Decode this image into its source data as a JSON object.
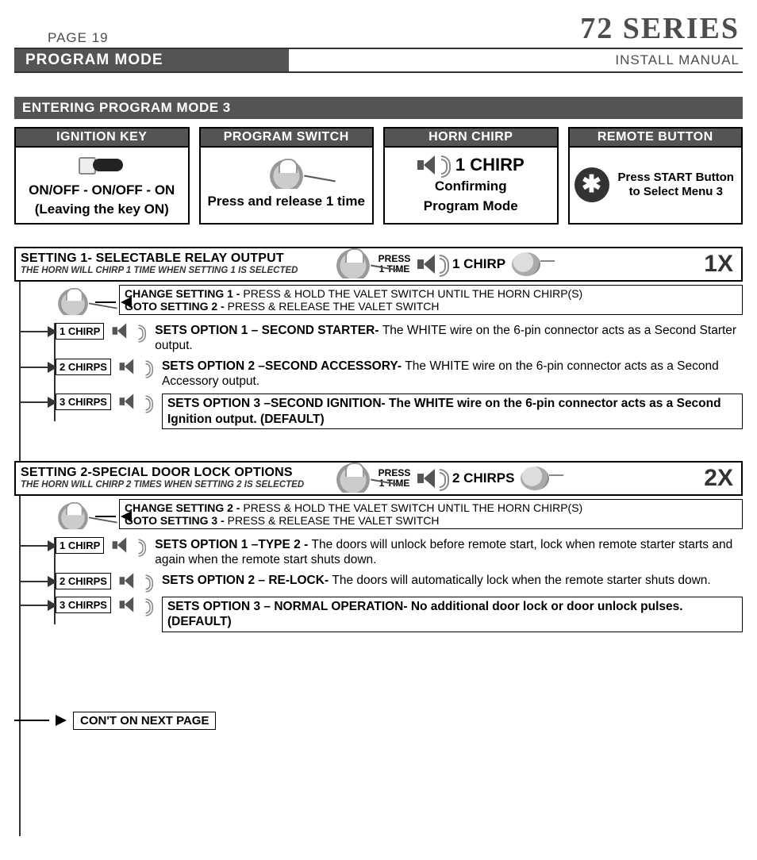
{
  "header": {
    "page_label": "PAGE 19",
    "series_title": "72 SERIES",
    "mode_band": "PROGRAM MODE",
    "doc_type": "INSTALL MANUAL"
  },
  "section_title": "ENTERING PROGRAM MODE 3",
  "steps": {
    "ignition": {
      "title": "IGNITION KEY",
      "line1": "ON/OFF -  ON/OFF  - ON",
      "line2": "(Leaving the key ON)"
    },
    "program_switch": {
      "title": "PROGRAM SWITCH",
      "caption": "Press and release 1 time"
    },
    "horn_chirp": {
      "title": "HORN CHIRP",
      "big": "1 CHIRP",
      "line1": "Confirming",
      "line2": "Program Mode"
    },
    "remote_button": {
      "title": "REMOTE BUTTON",
      "text": "Press START Button to Select Menu 3",
      "icon_glyph": "✱"
    }
  },
  "settings": [
    {
      "id": 1,
      "title": "SETTING 1- SELECTABLE RELAY OUTPUT",
      "subtitle": "THE HORN WILL CHIRP 1 TIME WHEN SETTING 1 IS SELECTED",
      "press_label": "PRESS 1 TIME",
      "chirp_label": "1 CHIRP",
      "count_label": "1X",
      "change_line1_b": "CHANGE SETTING 1 - ",
      "change_line1": "PRESS & HOLD THE VALET SWITCH UNTIL THE HORN CHIRP(S)",
      "change_line2_b": "GOTO SETTING 2 - ",
      "change_line2": "PRESS & RELEASE THE VALET SWITCH",
      "options": [
        {
          "tag": "1 CHIRP",
          "bold": "SETS OPTION 1 – SECOND STARTER- ",
          "rest": "The WHITE wire on the 6-pin connector acts as a Second Starter output.",
          "default": false
        },
        {
          "tag": "2 CHIRPS",
          "bold": "SETS OPTION 2 –SECOND ACCESSORY- ",
          "rest": "The WHITE wire on the 6-pin connector acts as a Second Accessory output.",
          "default": false
        },
        {
          "tag": "3 CHIRPS",
          "bold": "SETS OPTION 3 –SECOND IGNITION- The WHITE wire on the 6-pin connector acts as a Second Ignition output. (DEFAULT)",
          "rest": "",
          "default": true
        }
      ]
    },
    {
      "id": 2,
      "title": "SETTING 2-SPECIAL DOOR LOCK OPTIONS",
      "subtitle": "THE HORN WILL CHIRP 2 TIMES WHEN SETTING 2 IS SELECTED",
      "press_label": "PRESS 1 TIME",
      "chirp_label": "2 CHIRPS",
      "count_label": "2X",
      "change_line1_b": "CHANGE SETTING 2 - ",
      "change_line1": "PRESS & HOLD THE VALET SWITCH UNTIL THE HORN CHIRP(S)",
      "change_line2_b": "GOTO SETTING 3 - ",
      "change_line2": "PRESS & RELEASE THE VALET SWITCH",
      "options": [
        {
          "tag": "1 CHIRP",
          "bold": "SETS OPTION 1 –TYPE 2 - ",
          "rest": "The doors will unlock before remote start, lock when remote starter starts and again when the remote start shuts down.",
          "default": false
        },
        {
          "tag": "2 CHIRPS",
          "bold": "SETS OPTION 2 – RE-LOCK- ",
          "rest": "The doors will automatically lock when the remote starter shuts down.",
          "default": false
        },
        {
          "tag": "3 CHIRPS",
          "bold": "SETS OPTION 3 – NORMAL OPERATION- No additional door lock or door unlock pulses. (DEFAULT)",
          "rest": "",
          "default": true
        }
      ]
    }
  ],
  "continue_label": "CON'T ON NEXT PAGE"
}
